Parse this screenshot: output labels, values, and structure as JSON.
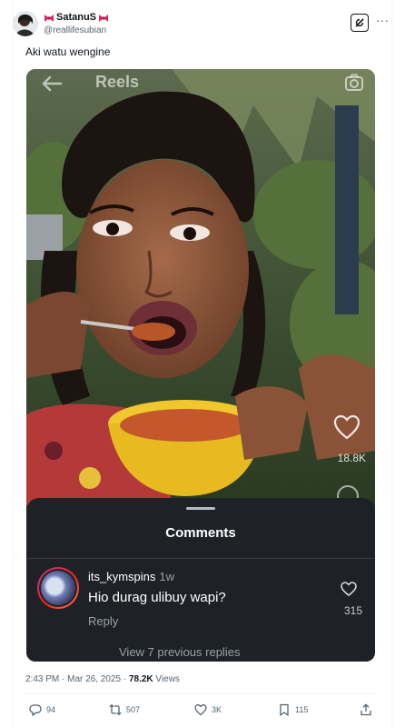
{
  "author": {
    "display_name": "SatanuS",
    "handle": "@reallifesubian"
  },
  "tweet": {
    "text": "Aki watu wengine"
  },
  "video": {
    "top_label": "Reels",
    "side_like_count": "18.8K"
  },
  "comments_sheet": {
    "title": "Comments",
    "comment": {
      "username": "its_kymspins",
      "time": "1w",
      "text": "Hio durag ulibuy wapi?",
      "reply_label": "Reply",
      "likes": "315"
    },
    "view_replies": "View 7 previous replies"
  },
  "meta": {
    "timestamp": "2:43 PM · Mar 26, 2025 · ",
    "views_count": "78.2K",
    "views_label": " Views"
  },
  "actions": {
    "replies": "94",
    "reposts": "507",
    "likes": "3K",
    "bookmarks": "115"
  }
}
